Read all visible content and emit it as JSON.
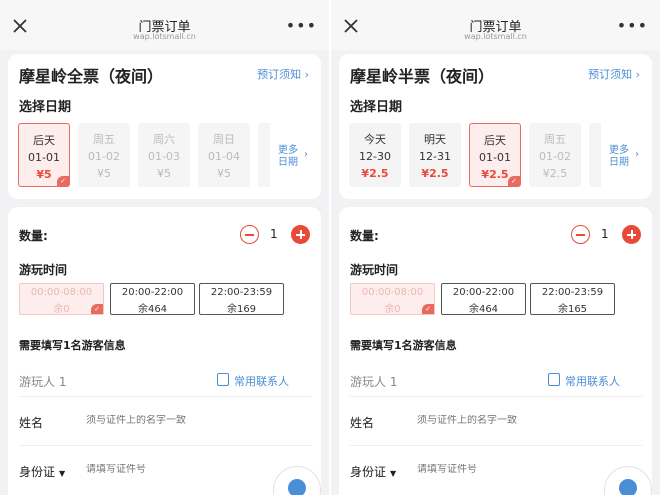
{
  "panels": [
    {
      "header": {
        "title": "门票订单",
        "url": "wap.lotsmall.cn"
      },
      "ticket_title": "摩星岭全票（夜间）",
      "notice_link": "预订须知",
      "select_date_label": "选择日期",
      "dates": [
        {
          "day": "后天",
          "date": "01-01",
          "price": "¥5",
          "state": "selected"
        },
        {
          "day": "周五",
          "date": "01-02",
          "price": "¥5",
          "state": "unavailable"
        },
        {
          "day": "周六",
          "date": "01-03",
          "price": "¥5",
          "state": "unavailable"
        },
        {
          "day": "周日",
          "date": "01-04",
          "price": "¥5",
          "state": "unavailable"
        }
      ],
      "more_dates": "更多日期",
      "quantity_label": "数量:",
      "quantity": "1",
      "play_time_label": "游玩时间",
      "slots": [
        {
          "time": "00:00-08:00",
          "remain": "余0",
          "state": "disabled"
        },
        {
          "time": "20:00-22:00",
          "remain": "余464",
          "state": "available"
        },
        {
          "time": "22:00-23:59",
          "remain": "余169",
          "state": "available"
        }
      ],
      "visitor_info_label": "需要填写1名游客信息",
      "visitor_label": "游玩人 1",
      "contacts_button": "常用联系人",
      "name_label": "姓名",
      "name_placeholder": "须与证件上的名字一致",
      "id_label": "身份证",
      "id_placeholder": "请填写证件号"
    },
    {
      "header": {
        "title": "门票订单",
        "url": "wap.lotsmall.cn"
      },
      "ticket_title": "摩星岭半票（夜间）",
      "notice_link": "预订须知",
      "select_date_label": "选择日期",
      "dates": [
        {
          "day": "今天",
          "date": "12-30",
          "price": "¥2.5",
          "state": "available"
        },
        {
          "day": "明天",
          "date": "12-31",
          "price": "¥2.5",
          "state": "available"
        },
        {
          "day": "后天",
          "date": "01-01",
          "price": "¥2.5",
          "state": "selected"
        },
        {
          "day": "周五",
          "date": "01-02",
          "price": "¥2.5",
          "state": "unavailable"
        }
      ],
      "more_dates": "更多日期",
      "quantity_label": "数量:",
      "quantity": "1",
      "play_time_label": "游玩时间",
      "slots": [
        {
          "time": "00:00-08:00",
          "remain": "余0",
          "state": "disabled"
        },
        {
          "time": "20:00-22:00",
          "remain": "余464",
          "state": "available"
        },
        {
          "time": "22:00-23:59",
          "remain": "余165",
          "state": "available"
        }
      ],
      "visitor_info_label": "需要填写1名游客信息",
      "visitor_label": "游玩人 1",
      "contacts_button": "常用联系人",
      "name_label": "姓名",
      "name_placeholder": "须与证件上的名字一致",
      "id_label": "身份证",
      "id_placeholder": "请填写证件号"
    }
  ],
  "icons": {
    "close": "close-icon",
    "more": "more-dots-icon",
    "chevron": "chevron-right-icon",
    "check": "check-corner-icon",
    "contacts": "contact-card-icon",
    "caret": "caret-down-icon",
    "floating": "user-avatar-icon"
  },
  "colors": {
    "accent_red": "#e84a3a",
    "link_blue": "#4a8fd6",
    "selected_bg": "#fdeeed",
    "page_bg": "#f2f2f4"
  }
}
